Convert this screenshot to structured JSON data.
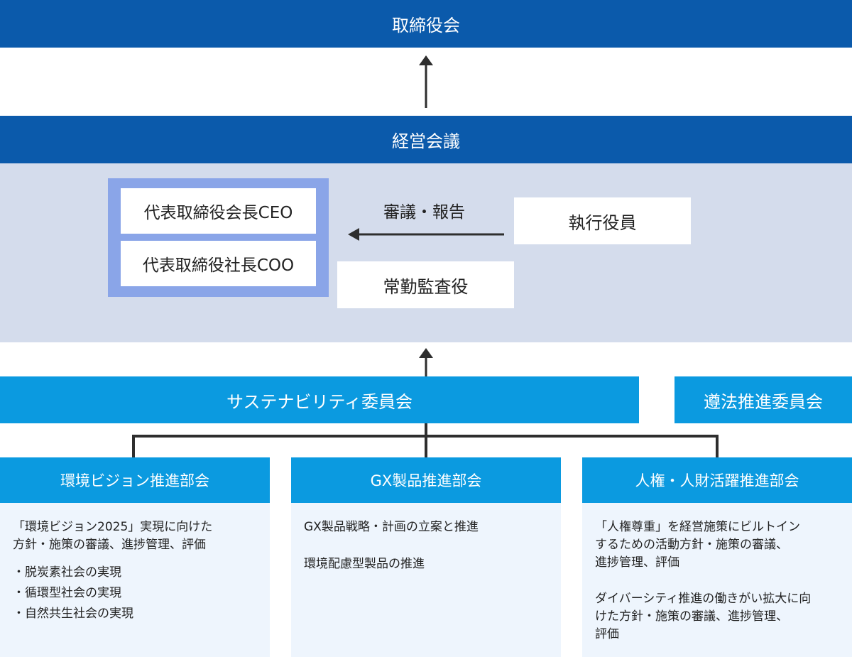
{
  "board": {
    "label": "取締役会"
  },
  "management": {
    "label": "経営会議",
    "chairman": "代表取締役会長CEO",
    "president": "代表取締役社長COO",
    "officers": "執行役員",
    "auditor": "常勤監査役",
    "arrow_label": "審議・報告"
  },
  "committees": {
    "sustainability": "サステナビリティ委員会",
    "compliance": "遵法推進委員会"
  },
  "departments": [
    {
      "title": "環境ビジョン推進部会",
      "desc": "「環境ビジョン2025」実現に向けた\n方針・施策の審議、進捗管理、評価",
      "items": [
        "・脱炭素社会の実現",
        "・循環型社会の実現",
        "・自然共生社会の実現"
      ]
    },
    {
      "title": "GX製品推進部会",
      "lines": [
        "GX製品戦略・計画の立案と推進",
        "環境配慮型製品の推進"
      ]
    },
    {
      "title": "人権・人財活躍推進部会",
      "lines": [
        "「人権尊重」を経営施策にビルトイン\nするための活動方針・施策の審議、\n進捗管理、評価",
        "ダイバーシティ推進の働きがい拡大に向\nけた方針・施策の審議、進捗管理、\n評価"
      ]
    }
  ],
  "colors": {
    "dark_blue": "#0b5aab",
    "light_blue": "#0b9ae0",
    "panel": "#d4dcec",
    "frame": "#8aa5e8",
    "dept_bg": "#eef5fd"
  }
}
